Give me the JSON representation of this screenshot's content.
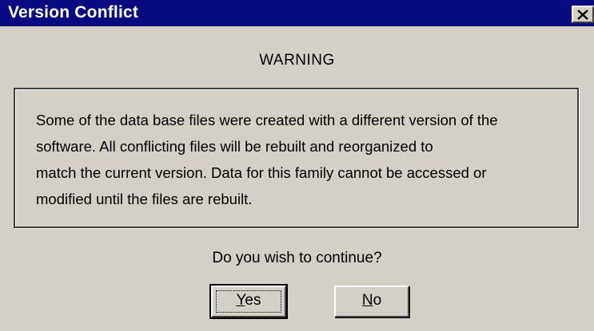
{
  "window": {
    "title": "Version Conflict",
    "close_icon": "close-icon"
  },
  "heading": "WARNING",
  "message": "Some of the data base files were created with a different version of the\nsoftware.  All conflicting files will be rebuilt and reorganized to\nmatch the current version.  Data for this family cannot be accessed or\nmodified until the files are rebuilt.",
  "question": "Do you wish to continue?",
  "buttons": {
    "yes": {
      "mnemonic": "Y",
      "rest": "es",
      "default": true
    },
    "no": {
      "mnemonic": "N",
      "rest": "o",
      "default": false
    }
  },
  "colors": {
    "titlebar": "#0a0a80",
    "face": "#d4d0c8",
    "title_text": "#ffffff"
  }
}
